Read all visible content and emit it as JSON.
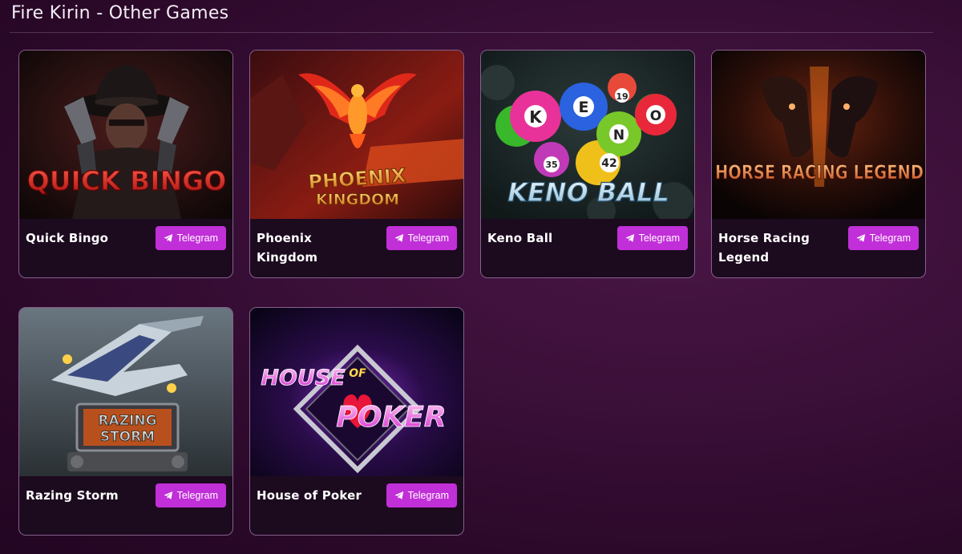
{
  "section": {
    "title": "Fire Kirin - Other Games"
  },
  "games": [
    {
      "title": "Quick Bingo",
      "button_label": "Telegram",
      "logo_text": "QUICK BINGO"
    },
    {
      "title": "Phoenix Kingdom",
      "button_label": "Telegram",
      "logo_line1": "PHOENIX",
      "logo_line2": "KINGDOM"
    },
    {
      "title": "Keno Ball",
      "button_label": "Telegram",
      "logo_text": "KENO BALL",
      "balls": [
        "K",
        "E",
        "N",
        "O",
        "19",
        "35",
        "42"
      ]
    },
    {
      "title": "Horse Racing Legend",
      "button_label": "Telegram",
      "logo_text": "HORSE RACING LEGEND"
    },
    {
      "title": "Razing Storm",
      "button_label": "Telegram",
      "logo_line1": "RAZING",
      "logo_line2": "STORM"
    },
    {
      "title": "House of Poker",
      "button_label": "Telegram",
      "logo_line1": "HOUSE",
      "logo_of": "OF",
      "logo_line2": "POKER"
    }
  ],
  "colors": {
    "button": "#c12fd8",
    "card_border": "#dcaae6",
    "background": "#3a0f38"
  },
  "icons": {
    "button_icon": "telegram-paper-plane-icon"
  }
}
